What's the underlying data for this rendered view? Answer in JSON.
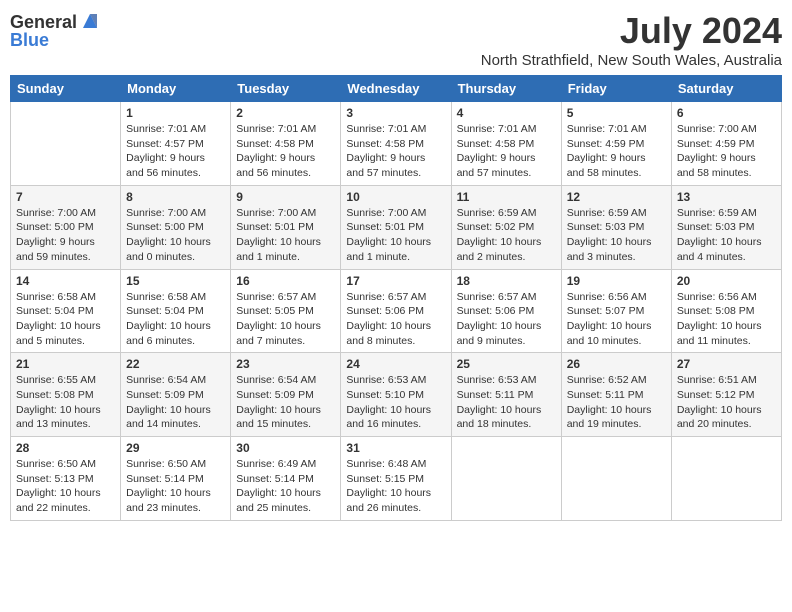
{
  "header": {
    "logo_general": "General",
    "logo_blue": "Blue",
    "month_year": "July 2024",
    "location": "North Strathfield, New South Wales, Australia"
  },
  "days_of_week": [
    "Sunday",
    "Monday",
    "Tuesday",
    "Wednesday",
    "Thursday",
    "Friday",
    "Saturday"
  ],
  "weeks": [
    [
      {
        "day": "",
        "info": ""
      },
      {
        "day": "1",
        "info": "Sunrise: 7:01 AM\nSunset: 4:57 PM\nDaylight: 9 hours and 56 minutes."
      },
      {
        "day": "2",
        "info": "Sunrise: 7:01 AM\nSunset: 4:58 PM\nDaylight: 9 hours and 56 minutes."
      },
      {
        "day": "3",
        "info": "Sunrise: 7:01 AM\nSunset: 4:58 PM\nDaylight: 9 hours and 57 minutes."
      },
      {
        "day": "4",
        "info": "Sunrise: 7:01 AM\nSunset: 4:58 PM\nDaylight: 9 hours and 57 minutes."
      },
      {
        "day": "5",
        "info": "Sunrise: 7:01 AM\nSunset: 4:59 PM\nDaylight: 9 hours and 58 minutes."
      },
      {
        "day": "6",
        "info": "Sunrise: 7:00 AM\nSunset: 4:59 PM\nDaylight: 9 hours and 58 minutes."
      }
    ],
    [
      {
        "day": "7",
        "info": "Sunrise: 7:00 AM\nSunset: 5:00 PM\nDaylight: 9 hours and 59 minutes."
      },
      {
        "day": "8",
        "info": "Sunrise: 7:00 AM\nSunset: 5:00 PM\nDaylight: 10 hours and 0 minutes."
      },
      {
        "day": "9",
        "info": "Sunrise: 7:00 AM\nSunset: 5:01 PM\nDaylight: 10 hours and 1 minute."
      },
      {
        "day": "10",
        "info": "Sunrise: 7:00 AM\nSunset: 5:01 PM\nDaylight: 10 hours and 1 minute."
      },
      {
        "day": "11",
        "info": "Sunrise: 6:59 AM\nSunset: 5:02 PM\nDaylight: 10 hours and 2 minutes."
      },
      {
        "day": "12",
        "info": "Sunrise: 6:59 AM\nSunset: 5:03 PM\nDaylight: 10 hours and 3 minutes."
      },
      {
        "day": "13",
        "info": "Sunrise: 6:59 AM\nSunset: 5:03 PM\nDaylight: 10 hours and 4 minutes."
      }
    ],
    [
      {
        "day": "14",
        "info": "Sunrise: 6:58 AM\nSunset: 5:04 PM\nDaylight: 10 hours and 5 minutes."
      },
      {
        "day": "15",
        "info": "Sunrise: 6:58 AM\nSunset: 5:04 PM\nDaylight: 10 hours and 6 minutes."
      },
      {
        "day": "16",
        "info": "Sunrise: 6:57 AM\nSunset: 5:05 PM\nDaylight: 10 hours and 7 minutes."
      },
      {
        "day": "17",
        "info": "Sunrise: 6:57 AM\nSunset: 5:06 PM\nDaylight: 10 hours and 8 minutes."
      },
      {
        "day": "18",
        "info": "Sunrise: 6:57 AM\nSunset: 5:06 PM\nDaylight: 10 hours and 9 minutes."
      },
      {
        "day": "19",
        "info": "Sunrise: 6:56 AM\nSunset: 5:07 PM\nDaylight: 10 hours and 10 minutes."
      },
      {
        "day": "20",
        "info": "Sunrise: 6:56 AM\nSunset: 5:08 PM\nDaylight: 10 hours and 11 minutes."
      }
    ],
    [
      {
        "day": "21",
        "info": "Sunrise: 6:55 AM\nSunset: 5:08 PM\nDaylight: 10 hours and 13 minutes."
      },
      {
        "day": "22",
        "info": "Sunrise: 6:54 AM\nSunset: 5:09 PM\nDaylight: 10 hours and 14 minutes."
      },
      {
        "day": "23",
        "info": "Sunrise: 6:54 AM\nSunset: 5:09 PM\nDaylight: 10 hours and 15 minutes."
      },
      {
        "day": "24",
        "info": "Sunrise: 6:53 AM\nSunset: 5:10 PM\nDaylight: 10 hours and 16 minutes."
      },
      {
        "day": "25",
        "info": "Sunrise: 6:53 AM\nSunset: 5:11 PM\nDaylight: 10 hours and 18 minutes."
      },
      {
        "day": "26",
        "info": "Sunrise: 6:52 AM\nSunset: 5:11 PM\nDaylight: 10 hours and 19 minutes."
      },
      {
        "day": "27",
        "info": "Sunrise: 6:51 AM\nSunset: 5:12 PM\nDaylight: 10 hours and 20 minutes."
      }
    ],
    [
      {
        "day": "28",
        "info": "Sunrise: 6:50 AM\nSunset: 5:13 PM\nDaylight: 10 hours and 22 minutes."
      },
      {
        "day": "29",
        "info": "Sunrise: 6:50 AM\nSunset: 5:14 PM\nDaylight: 10 hours and 23 minutes."
      },
      {
        "day": "30",
        "info": "Sunrise: 6:49 AM\nSunset: 5:14 PM\nDaylight: 10 hours and 25 minutes."
      },
      {
        "day": "31",
        "info": "Sunrise: 6:48 AM\nSunset: 5:15 PM\nDaylight: 10 hours and 26 minutes."
      },
      {
        "day": "",
        "info": ""
      },
      {
        "day": "",
        "info": ""
      },
      {
        "day": "",
        "info": ""
      }
    ]
  ]
}
